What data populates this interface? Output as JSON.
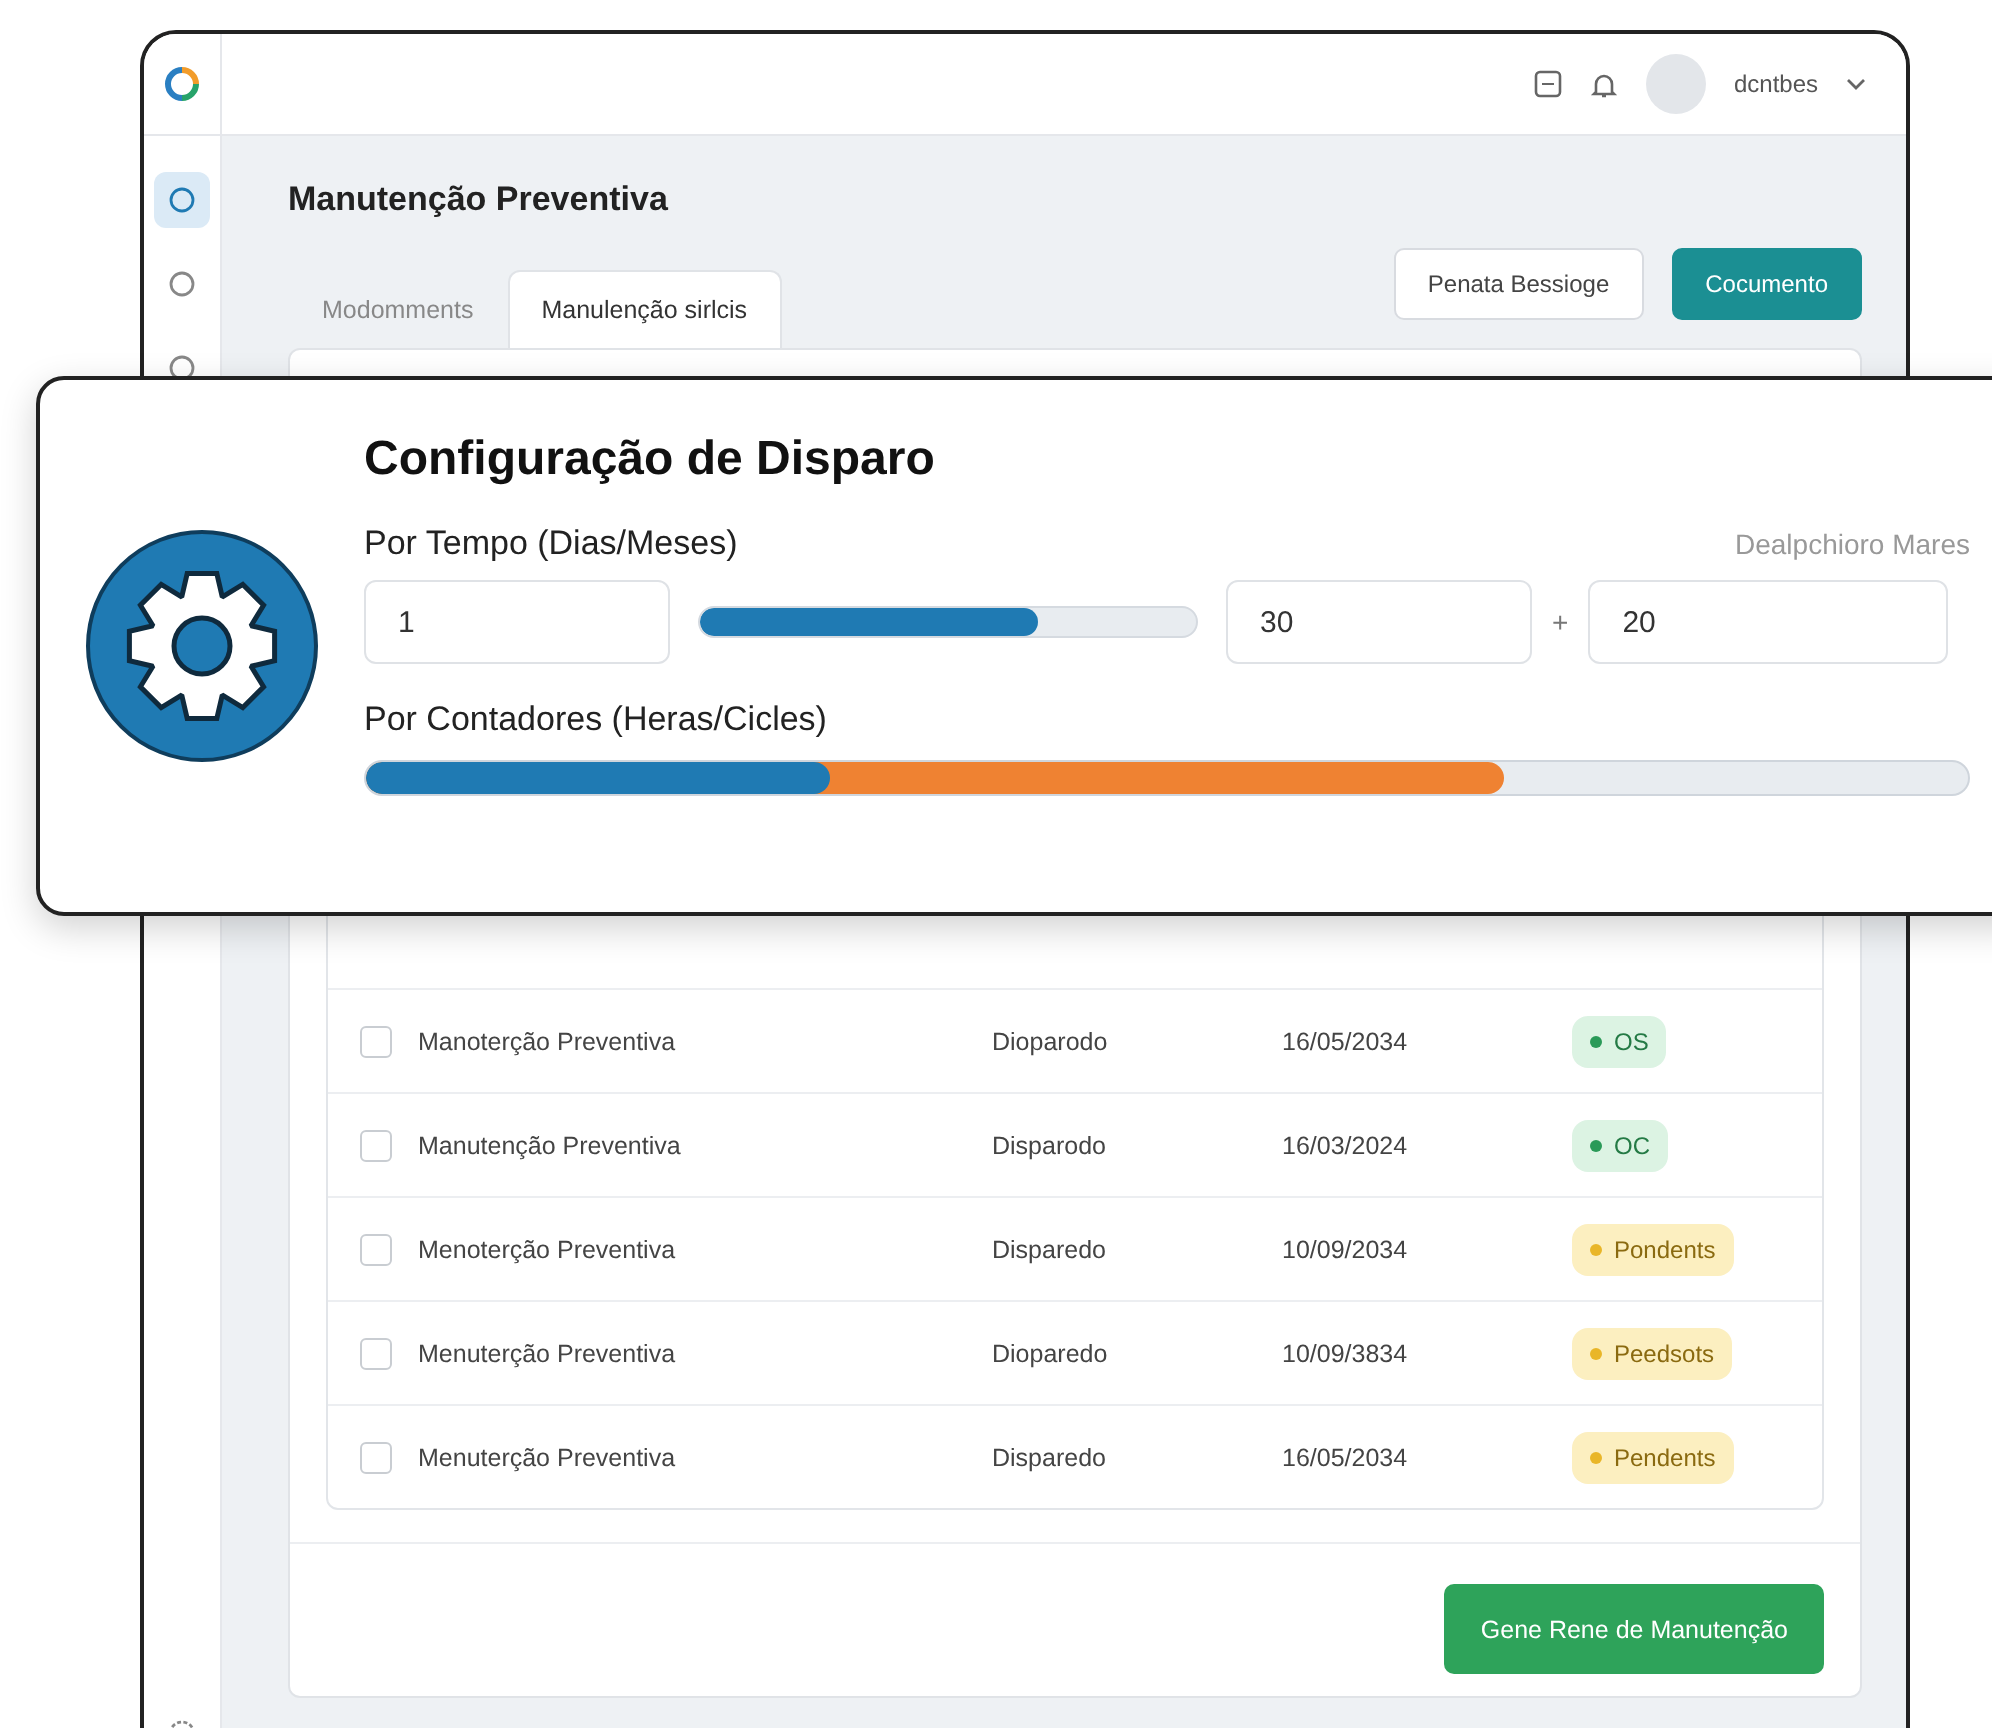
{
  "top_bar": {
    "user_name": "dcntbes"
  },
  "sidebar": {
    "items": [
      {
        "selected": true
      },
      {
        "selected": false
      },
      {
        "selected": false
      }
    ]
  },
  "page": {
    "title": "Manutenção Preventiva"
  },
  "tabs": [
    {
      "label": "Modomments",
      "selected": false
    },
    {
      "label": "Manulenção sirlcis",
      "selected": true
    }
  ],
  "actions": [
    {
      "label": "Penata Bessioge",
      "kind": "secondary"
    },
    {
      "label": "Cocumento",
      "kind": "primary"
    }
  ],
  "table": {
    "rows": [
      {
        "checked": false,
        "name": "Manoterção Preventiva",
        "status": "Dioparodo",
        "date": "16/05/2034",
        "badge": {
          "label": "OS",
          "kind": "ok"
        }
      },
      {
        "checked": false,
        "name": "Manutenção Preventiva",
        "status": "Disparodo",
        "date": "16/03/2024",
        "badge": {
          "label": "OC",
          "kind": "ok"
        }
      },
      {
        "checked": false,
        "name": "Menoterção Preventiva",
        "status": "Disparedo",
        "date": "10/09/2034",
        "badge": {
          "label": "Pondents",
          "kind": "pending"
        }
      },
      {
        "checked": false,
        "name": "Menuterção Preventiva",
        "status": "Dioparedo",
        "date": "10/09/3834",
        "badge": {
          "label": "Peedsots",
          "kind": "pending"
        }
      },
      {
        "checked": false,
        "name": "Menuterção Preventiva",
        "status": "Disparedo",
        "date": "16/05/2034",
        "badge": {
          "label": "Pendents",
          "kind": "pending"
        }
      }
    ]
  },
  "footer_button": "Gene Rene de Manutenção",
  "trigger_panel": {
    "title": "Configuração de Disparo",
    "time_label": "Por Tempo (Dias/Meses)",
    "side_label": "Dealpchioro Mares",
    "time_from": "1",
    "time_slider": {
      "level": 0.68
    },
    "time_to": "30",
    "plus": "+",
    "time_extra": "20",
    "counter_label": "Por Contadores (Heras/Cicles)",
    "counter_segments": [
      {
        "level": 0.29,
        "color": "#1f7ab3"
      },
      {
        "level": 0.71,
        "color": "#ef8232"
      }
    ]
  }
}
